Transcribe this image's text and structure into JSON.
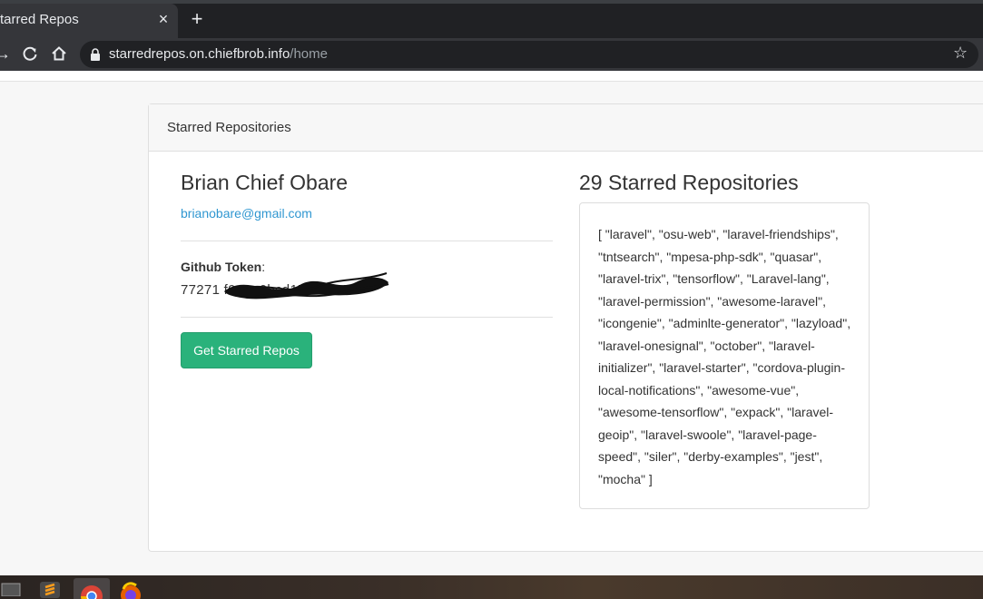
{
  "browser": {
    "tab_title": "tarred Repos",
    "tab_close": "×",
    "new_tab": "+",
    "url_host": "starredrepos.on.chiefbrob.info",
    "url_path": "/home"
  },
  "card": {
    "header": "Starred Repositories",
    "user_name": "Brian Chief Obare",
    "email": "brianobare@gmail.com",
    "token_label": "Github Token",
    "token_value": "77271                            f01ee0bcd17a6",
    "button_label": "Get Starred Repos",
    "count_title": "29 Starred Repositories",
    "repos_text": "[ \"laravel\", \"osu-web\", \"laravel-friendships\", \"tntsearch\", \"mpesa-php-sdk\", \"quasar\", \"laravel-trix\", \"tensorflow\", \"Laravel-lang\", \"laravel-permission\", \"awesome-laravel\", \"icongenie\", \"adminlte-generator\", \"lazyload\", \"laravel-onesignal\", \"october\", \"laravel-initializer\", \"laravel-starter\", \"cordova-plugin-local-notifications\", \"awesome-vue\", \"awesome-tensorflow\", \"expack\", \"laravel-geoip\", \"laravel-swoole\", \"laravel-page-speed\", \"siler\", \"derby-examples\", \"jest\", \"mocha\" ]"
  },
  "colors": {
    "link": "#3097d1",
    "button": "#2ab27b"
  }
}
